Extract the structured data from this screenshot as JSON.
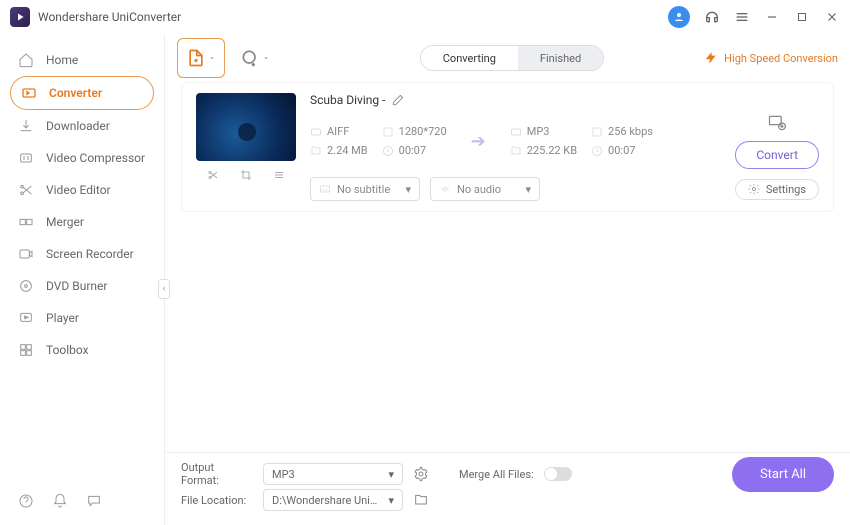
{
  "app": {
    "title": "Wondershare UniConverter"
  },
  "sidebar": {
    "items": [
      {
        "label": "Home"
      },
      {
        "label": "Converter"
      },
      {
        "label": "Downloader"
      },
      {
        "label": "Video Compressor"
      },
      {
        "label": "Video Editor"
      },
      {
        "label": "Merger"
      },
      {
        "label": "Screen Recorder"
      },
      {
        "label": "DVD Burner"
      },
      {
        "label": "Player"
      },
      {
        "label": "Toolbox"
      }
    ]
  },
  "toolbar": {
    "tabs": {
      "converting": "Converting",
      "finished": "Finished"
    },
    "hsc": "High Speed Conversion"
  },
  "file": {
    "name": "Scuba Diving -",
    "src_format": "AIFF",
    "src_res": "1280*720",
    "src_size": "2.24 MB",
    "src_dur": "00:07",
    "dst_format": "MP3",
    "dst_bitrate": "256 kbps",
    "dst_size": "225.22 KB",
    "dst_dur": "00:07",
    "subtitle_placeholder": "No subtitle",
    "audio_placeholder": "No audio",
    "settings_label": "Settings",
    "convert_label": "Convert"
  },
  "footer": {
    "output_format_label": "Output Format:",
    "output_format_value": "MP3",
    "file_location_label": "File Location:",
    "file_location_value": "D:\\Wondershare UniConverter",
    "merge_label": "Merge All Files:",
    "start_all": "Start All"
  }
}
